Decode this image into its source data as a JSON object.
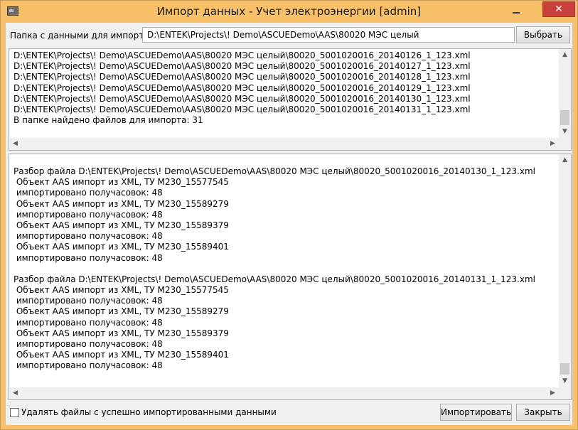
{
  "window": {
    "title": "Импорт данных - Учет электроэнергии [admin]",
    "close_symbol": "✕",
    "app_icon": "app-window-icon"
  },
  "folder": {
    "label": "Папка с данными для импорта",
    "path": "D:\\ENTEK\\Projects\\! Demo\\ASCUEDemo\\AAS\\80020 МЭС целый",
    "browse_label": "Выбрать"
  },
  "file_log": {
    "lines": [
      "D:\\ENTEK\\Projects\\! Demo\\ASCUEDemo\\AAS\\80020 МЭС целый\\80020_5001020016_20140126_1_123.xml",
      "D:\\ENTEK\\Projects\\! Demo\\ASCUEDemo\\AAS\\80020 МЭС целый\\80020_5001020016_20140127_1_123.xml",
      "D:\\ENTEK\\Projects\\! Demo\\ASCUEDemo\\AAS\\80020 МЭС целый\\80020_5001020016_20140128_1_123.xml",
      "D:\\ENTEK\\Projects\\! Demo\\ASCUEDemo\\AAS\\80020 МЭС целый\\80020_5001020016_20140129_1_123.xml",
      "D:\\ENTEK\\Projects\\! Demo\\ASCUEDemo\\AAS\\80020 МЭС целый\\80020_5001020016_20140130_1_123.xml",
      "D:\\ENTEK\\Projects\\! Demo\\ASCUEDemo\\AAS\\80020 МЭС целый\\80020_5001020016_20140131_1_123.xml",
      "В папке найдено файлов для импорта: 31"
    ]
  },
  "import_log": {
    "lines": [
      "Разбор файла D:\\ENTEK\\Projects\\! Demo\\ASCUEDemo\\AAS\\80020 МЭС целый\\80020_5001020016_20140130_1_123.xml",
      " Объект AAS импорт из XML, ТУ M230_15577545",
      " импортировано получасовок: 48",
      " Объект AAS импорт из XML, ТУ M230_15589279",
      " импортировано получасовок: 48",
      " Объект AAS импорт из XML, ТУ M230_15589379",
      " импортировано получасовок: 48",
      " Объект AAS импорт из XML, ТУ M230_15589401",
      " импортировано получасовок: 48",
      "",
      "Разбор файла D:\\ENTEK\\Projects\\! Demo\\ASCUEDemo\\AAS\\80020 МЭС целый\\80020_5001020016_20140131_1_123.xml",
      " Объект AAS импорт из XML, ТУ M230_15577545",
      " импортировано получасовок: 48",
      " Объект AAS импорт из XML, ТУ M230_15589279",
      " импортировано получасовок: 48",
      " Объект AAS импорт из XML, ТУ M230_15589379",
      " импортировано получасовок: 48",
      " Объект AAS импорт из XML, ТУ M230_15589401",
      " импортировано получасовок: 48"
    ]
  },
  "options": {
    "delete_files_label": "Удалять файлы с успешно импортированными данными",
    "delete_files_checked": false
  },
  "buttons": {
    "import_label": "Импортировать",
    "close_label": "Закрыть"
  },
  "scroll_arrows": {
    "up": "▲",
    "down": "▼",
    "left": "◀",
    "right": "▶"
  }
}
